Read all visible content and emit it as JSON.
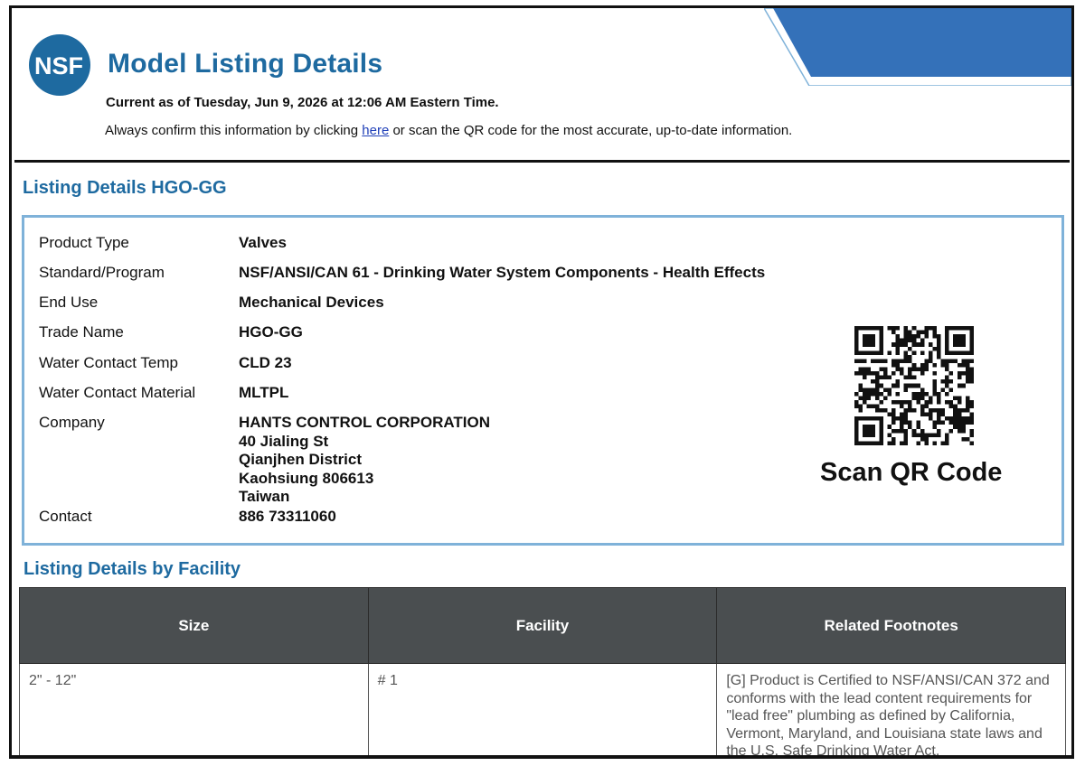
{
  "header": {
    "logo_text": "NSF",
    "title": "Model Listing Details",
    "current_as_of": "Current as of Tuesday, Jun 9, 2026 at 12:06 AM Eastern Time.",
    "confirm_prefix": "Always confirm this information by clicking ",
    "confirm_link": "here",
    "confirm_suffix": " or scan the QR code for the  most accurate, up-to-date information."
  },
  "colors": {
    "title_blue": "#1e6aa0",
    "box_border": "#7fb2d9",
    "banner_blue": "#3471b9",
    "table_header": "#4a4e50"
  },
  "listing": {
    "heading": "Listing Details HGO-GG",
    "rows": [
      {
        "label": "Product Type",
        "value": "Valves"
      },
      {
        "label": "Standard/Program",
        "value": "NSF/ANSI/CAN 61 - Drinking Water System Components - Health Effects"
      },
      {
        "label": "End Use",
        "value": "Mechanical Devices"
      },
      {
        "label": "Trade Name",
        "value": "HGO-GG"
      },
      {
        "label": "Water Contact Temp",
        "value": "CLD 23"
      },
      {
        "label": "Water Contact Material",
        "value": "MLTPL"
      }
    ],
    "company": {
      "label": "Company",
      "name": "HANTS CONTROL CORPORATION",
      "street": "40 Jialing St",
      "district": "Qianjhen District",
      "city": "Kaohsiung 806613",
      "country": "Taiwan"
    },
    "contact": {
      "label": "Contact",
      "value": "886 73311060"
    },
    "qr_caption": "Scan QR Code",
    "qr_icon": "qr-code-icon"
  },
  "facility": {
    "heading": "Listing Details by Facility",
    "columns": [
      "Size",
      "Facility",
      "Related Footnotes"
    ],
    "rows": [
      {
        "size": "2\" - 12\"",
        "facility": "# 1",
        "footnote": "[G] Product is Certified to NSF/ANSI/CAN 372 and conforms with the lead content requirements for \"lead free\" plumbing as defined by California, Vermont, Maryland, and Louisiana state laws and the U.S. Safe Drinking Water Act."
      }
    ]
  }
}
